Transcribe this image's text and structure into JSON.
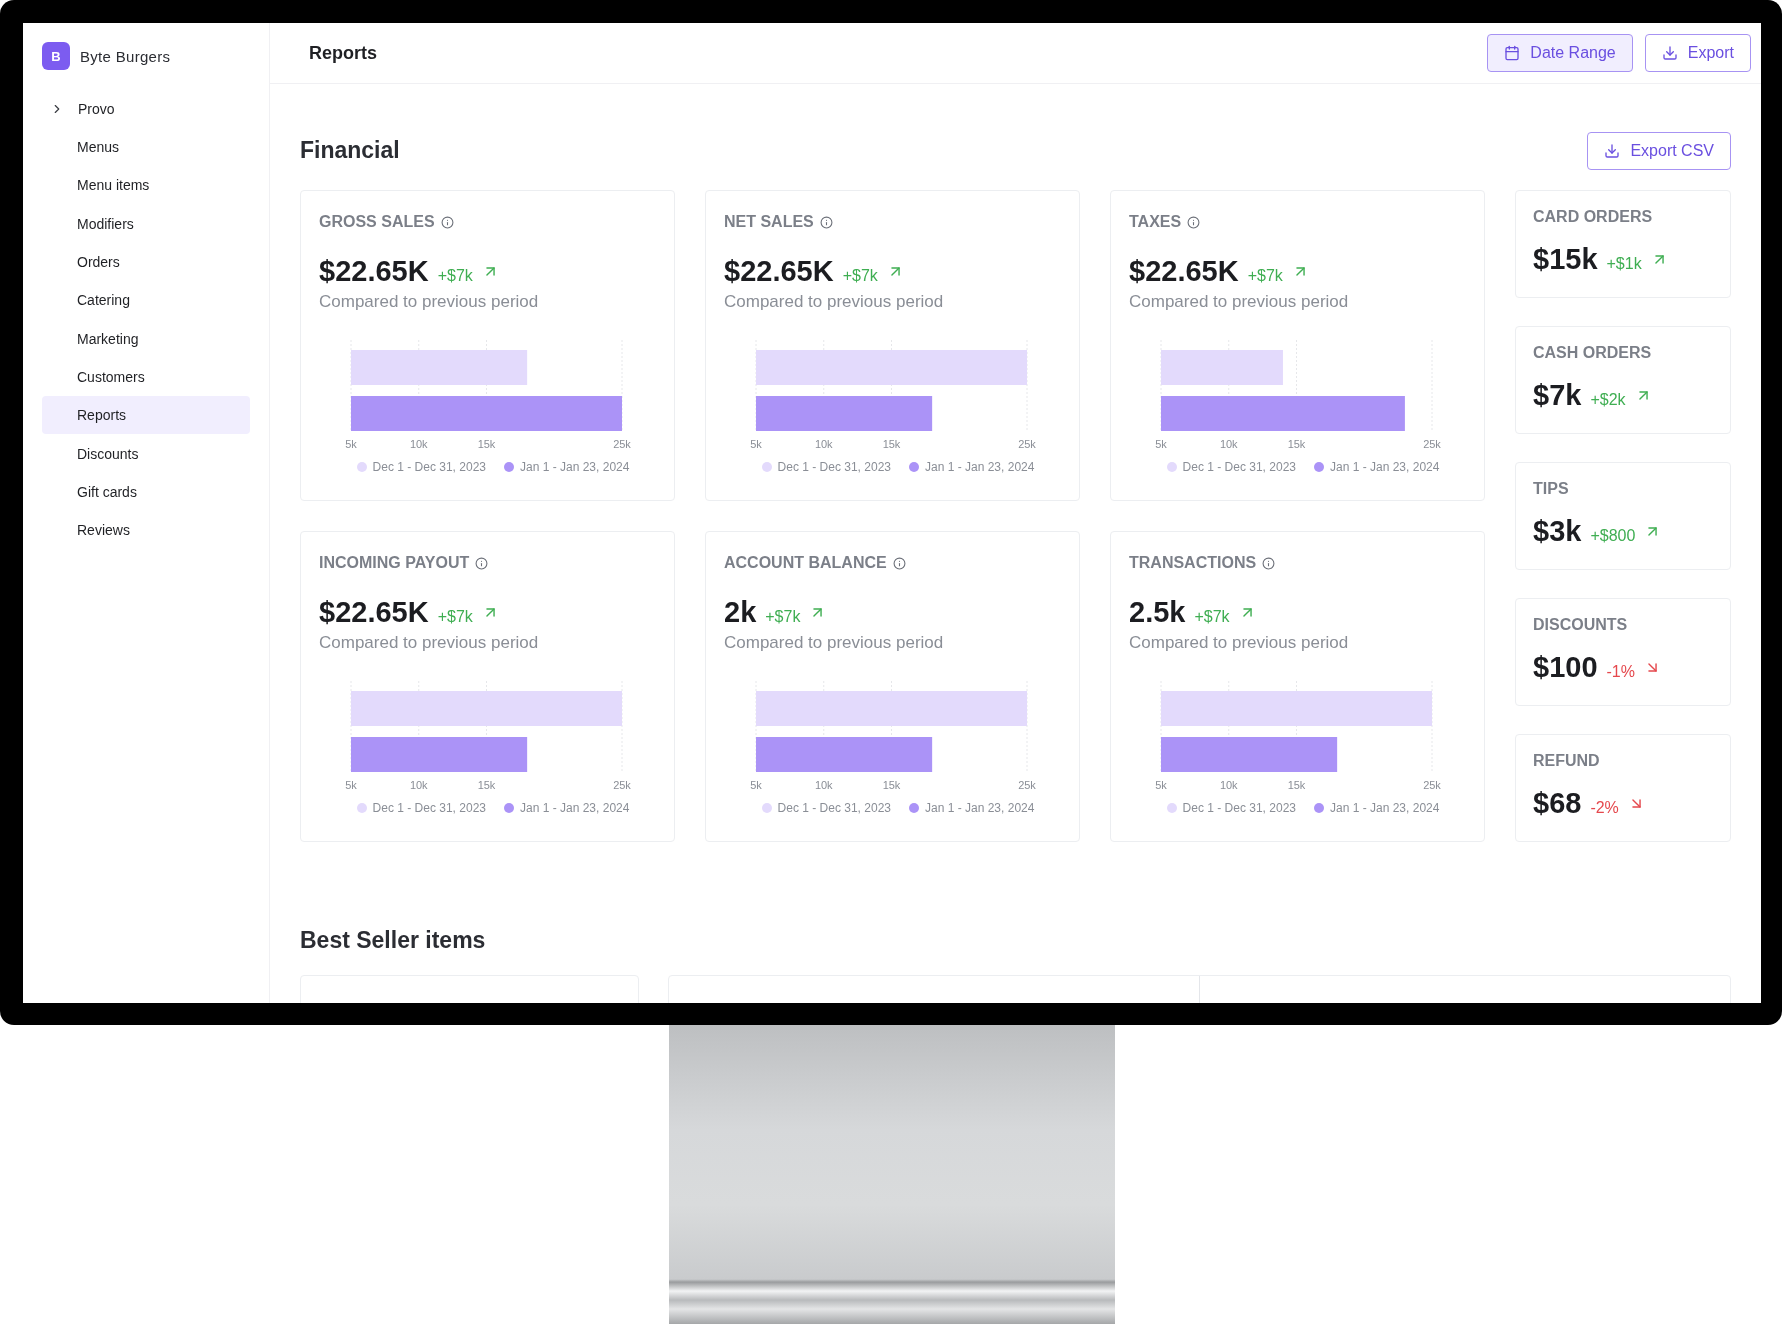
{
  "brand": {
    "logo": "B",
    "name": "Byte Burgers"
  },
  "location": {
    "label": "Provo",
    "expanded": false
  },
  "sidebar": {
    "items": [
      {
        "label": "Menus",
        "selected": false
      },
      {
        "label": "Menu items",
        "selected": false
      },
      {
        "label": "Modifiers",
        "selected": false
      },
      {
        "label": "Orders",
        "selected": false
      },
      {
        "label": "Catering",
        "selected": false
      },
      {
        "label": "Marketing",
        "selected": false
      },
      {
        "label": "Customers",
        "selected": false
      },
      {
        "label": "Reports",
        "selected": true
      },
      {
        "label": "Discounts",
        "selected": false
      },
      {
        "label": "Gift cards",
        "selected": false
      },
      {
        "label": "Reviews",
        "selected": false
      }
    ]
  },
  "header": {
    "title": "Reports",
    "buttons": [
      {
        "label": "Date Range",
        "kind": "calendar",
        "active": true
      },
      {
        "label": "Export",
        "kind": "download",
        "active": false
      }
    ]
  },
  "financial": {
    "title": "Financial",
    "export_button": "Export CSV",
    "metrics": [
      {
        "title": "GROSS SALES",
        "value": "$22.65K",
        "change": "+$7k",
        "rising": true,
        "note": "Compared to previous period",
        "chart_data": {
          "type": "bar",
          "orientation": "horizontal",
          "legend": "bottom",
          "xlim": [
            5000,
            25000
          ],
          "xticks": [
            {
              "value": 5000,
              "label": "5k"
            },
            {
              "value": 10000,
              "label": "10k"
            },
            {
              "value": 15000,
              "label": "15k"
            },
            {
              "value": 25000,
              "label": "25k"
            }
          ],
          "series": [
            {
              "name": "Dec 1 - Dec 31, 2023",
              "color": "#e3dafc",
              "values": [
                18000
              ]
            },
            {
              "name": "Jan 1 - Jan 23, 2024",
              "color": "#ab93f7",
              "values": [
                25000
              ]
            }
          ]
        }
      },
      {
        "title": "NET SALES",
        "value": "$22.65K",
        "change": "+$7k",
        "rising": true,
        "note": "Compared to previous period",
        "chart_data": {
          "type": "bar",
          "orientation": "horizontal",
          "legend": "bottom",
          "xlim": [
            5000,
            25000
          ],
          "xticks": [
            {
              "value": 5000,
              "label": "5k"
            },
            {
              "value": 10000,
              "label": "10k"
            },
            {
              "value": 15000,
              "label": "15k"
            },
            {
              "value": 25000,
              "label": "25k"
            }
          ],
          "series": [
            {
              "name": "Dec 1 - Dec 31, 2023",
              "color": "#e3dafc",
              "values": [
                25000
              ]
            },
            {
              "name": "Jan 1 - Jan 23, 2024",
              "color": "#ab93f7",
              "values": [
                18000
              ]
            }
          ]
        }
      },
      {
        "title": "TAXES",
        "value": "$22.65K",
        "change": "+$7k",
        "rising": true,
        "note": "Compared to previous period",
        "chart_data": {
          "type": "bar",
          "orientation": "horizontal",
          "legend": "bottom",
          "xlim": [
            5000,
            25000
          ],
          "xticks": [
            {
              "value": 5000,
              "label": "5k"
            },
            {
              "value": 10000,
              "label": "10k"
            },
            {
              "value": 15000,
              "label": "15k"
            },
            {
              "value": 25000,
              "label": "25k"
            }
          ],
          "series": [
            {
              "name": "Dec 1 - Dec 31, 2023",
              "color": "#e3dafc",
              "values": [
                14000
              ]
            },
            {
              "name": "Jan 1 - Jan 23, 2024",
              "color": "#ab93f7",
              "values": [
                23000
              ]
            }
          ]
        }
      },
      {
        "title": "INCOMING PAYOUT",
        "value": "$22.65K",
        "change": "+$7k",
        "rising": true,
        "note": "Compared to previous period",
        "chart_data": {
          "type": "bar",
          "orientation": "horizontal",
          "legend": "bottom",
          "xlim": [
            5000,
            25000
          ],
          "xticks": [
            {
              "value": 5000,
              "label": "5k"
            },
            {
              "value": 10000,
              "label": "10k"
            },
            {
              "value": 15000,
              "label": "15k"
            },
            {
              "value": 25000,
              "label": "25k"
            }
          ],
          "series": [
            {
              "name": "Dec 1 - Dec 31, 2023",
              "color": "#e3dafc",
              "values": [
                25000
              ]
            },
            {
              "name": "Jan 1 - Jan 23, 2024",
              "color": "#ab93f7",
              "values": [
                18000
              ]
            }
          ]
        }
      },
      {
        "title": "ACCOUNT BALANCE",
        "value": "2k",
        "change": "+$7k",
        "rising": true,
        "note": "Compared to previous period",
        "chart_data": {
          "type": "bar",
          "orientation": "horizontal",
          "legend": "bottom",
          "xlim": [
            5000,
            25000
          ],
          "xticks": [
            {
              "value": 5000,
              "label": "5k"
            },
            {
              "value": 10000,
              "label": "10k"
            },
            {
              "value": 15000,
              "label": "15k"
            },
            {
              "value": 25000,
              "label": "25k"
            }
          ],
          "series": [
            {
              "name": "Dec 1 - Dec 31, 2023",
              "color": "#e3dafc",
              "values": [
                25000
              ]
            },
            {
              "name": "Jan 1 - Jan 23, 2024",
              "color": "#ab93f7",
              "values": [
                18000
              ]
            }
          ]
        }
      },
      {
        "title": "TRANSACTIONS",
        "value": "2.5k",
        "change": "+$7k",
        "rising": true,
        "note": "Compared to previous period",
        "chart_data": {
          "type": "bar",
          "orientation": "horizontal",
          "legend": "bottom",
          "xlim": [
            5000,
            25000
          ],
          "xticks": [
            {
              "value": 5000,
              "label": "5k"
            },
            {
              "value": 10000,
              "label": "10k"
            },
            {
              "value": 15000,
              "label": "15k"
            },
            {
              "value": 25000,
              "label": "25k"
            }
          ],
          "series": [
            {
              "name": "Dec 1 - Dec 31, 2023",
              "color": "#e3dafc",
              "values": [
                25000
              ]
            },
            {
              "name": "Jan 1 - Jan 23, 2024",
              "color": "#ab93f7",
              "values": [
                18000
              ]
            }
          ]
        }
      }
    ],
    "side_metrics": [
      {
        "title": "CARD ORDERS",
        "value": "$15k",
        "change": "+$1k",
        "rising": true
      },
      {
        "title": "CASH ORDERS",
        "value": "$7k",
        "change": "+$2k",
        "rising": true
      },
      {
        "title": "TIPS",
        "value": "$3k",
        "change": "+$800",
        "rising": true
      },
      {
        "title": "DISCOUNTS",
        "value": "$100",
        "change": "-1%",
        "rising": false
      },
      {
        "title": "REFUND",
        "value": "$68",
        "change": "-2%",
        "rising": false
      }
    ]
  },
  "best_sellers": {
    "title": "Best Seller items"
  }
}
